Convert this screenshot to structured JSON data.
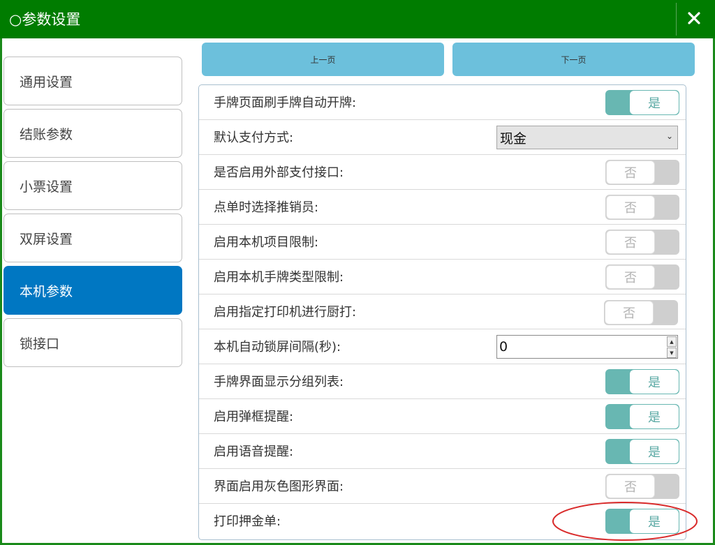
{
  "titlebar": {
    "title": "○参数设置",
    "close_icon": "close-icon",
    "bg": "#007c00"
  },
  "sidebar": {
    "items": [
      {
        "label": "通用设置",
        "active": false
      },
      {
        "label": "结账参数",
        "active": false
      },
      {
        "label": "小票设置",
        "active": false
      },
      {
        "label": "双屏设置",
        "active": false
      },
      {
        "label": "本机参数",
        "active": true
      },
      {
        "label": "锁接口",
        "active": false
      }
    ],
    "active_color": "#0077c2"
  },
  "pager": {
    "prev_label": "上一页",
    "next_label": "下一页",
    "color": "#6cc0dc"
  },
  "settings": {
    "rows": [
      {
        "label": "手牌页面刷手牌自动开牌:",
        "control": "toggle",
        "value": "是",
        "on": true
      },
      {
        "label": "默认支付方式:",
        "control": "select",
        "value": "现金"
      },
      {
        "label": "是否启用外部支付接口:",
        "control": "toggle",
        "value": "否",
        "on": false
      },
      {
        "label": "点单时选择推销员:",
        "control": "toggle",
        "value": "否",
        "on": false
      },
      {
        "label": "启用本机项目限制:",
        "control": "toggle",
        "value": "否",
        "on": false
      },
      {
        "label": "启用本机手牌类型限制:",
        "control": "toggle",
        "value": "否",
        "on": false
      },
      {
        "label": "启用指定打印机进行厨打:",
        "control": "toggle",
        "value": "否",
        "on": false
      },
      {
        "label": "本机自动锁屏间隔(秒):",
        "control": "number",
        "value": "0"
      },
      {
        "label": "手牌界面显示分组列表:",
        "control": "toggle",
        "value": "是",
        "on": true
      },
      {
        "label": "启用弹框提醒:",
        "control": "toggle",
        "value": "是",
        "on": true
      },
      {
        "label": "启用语音提醒:",
        "control": "toggle",
        "value": "是",
        "on": true
      },
      {
        "label": "界面启用灰色图形界面:",
        "control": "toggle",
        "value": "否",
        "on": false
      },
      {
        "label": "打印押金单:",
        "control": "toggle",
        "value": "是",
        "on": true
      }
    ],
    "toggle_on_color": "#68b7b2",
    "toggle_off_color": "#cfcfcf"
  },
  "annotation": {
    "shape": "ellipse",
    "color": "#d92b2b"
  }
}
